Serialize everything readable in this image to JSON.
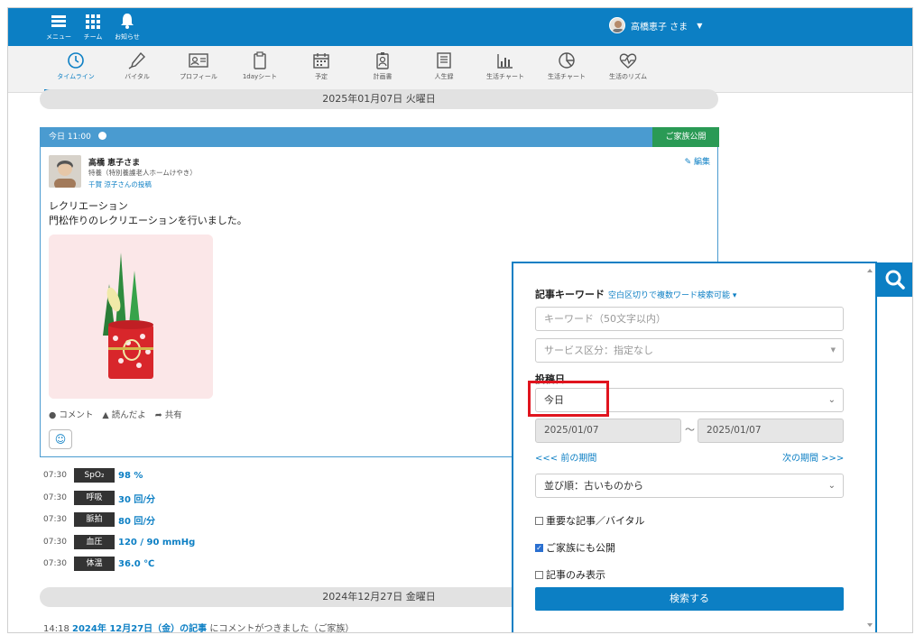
{
  "header": {
    "menu_label": "メニュー",
    "team_label": "チーム",
    "notice_label": "お知らせ",
    "user_name": "高橋恵子 さま",
    "user_menu_icon": "caret-down-icon"
  },
  "tabs": [
    {
      "label": "タイムライン",
      "icon": "clock-icon",
      "active": true
    },
    {
      "label": "バイタル",
      "icon": "thermometer-icon"
    },
    {
      "label": "プロフィール",
      "icon": "id-card-icon"
    },
    {
      "label": "1dayシート",
      "icon": "clipboard-icon"
    },
    {
      "label": "予定",
      "icon": "calendar-icon"
    },
    {
      "label": "計画書",
      "icon": "badge-icon"
    },
    {
      "label": "人生録",
      "icon": "notebook-icon"
    },
    {
      "label": "生活チャート",
      "icon": "bar-chart-icon"
    },
    {
      "label": "生活チャート",
      "icon": "pie-chart-icon"
    },
    {
      "label": "生活のリズム",
      "icon": "heartbeat-icon"
    }
  ],
  "timeline": {
    "date1": "2025年01月07日 火曜日",
    "date2": "2024年12月27日 金曜日"
  },
  "post": {
    "time": "今日 11:00",
    "family_tag": "ご家族公開",
    "edit_label": "編集",
    "name": "高橋 恵子さま",
    "facility": "特養（特別養護老人ホームけやき）",
    "posted_by": "千賀 涼子さんの投稿",
    "title": "レクリエーション",
    "body": "門松作りのレクリエーションを行いました。",
    "comment_label": "コメント",
    "read_label": "読んだよ",
    "share_label": "共有",
    "emoji_label": "☺"
  },
  "vitals": [
    {
      "time": "07:30",
      "name": "SpO₂",
      "value": "98 %"
    },
    {
      "time": "07:30",
      "name": "呼吸",
      "value": "30 回/分"
    },
    {
      "time": "07:30",
      "name": "脈拍",
      "value": "80 回/分"
    },
    {
      "time": "07:30",
      "name": "血圧",
      "value": "120 / 90 mmHg"
    },
    {
      "time": "07:30",
      "name": "体温",
      "value": "36.0 ℃"
    }
  ],
  "notice": {
    "time": "14:18",
    "link": "2024年 12月27日（金）の記事",
    "text": "にコメントがつきました（ご家族）"
  },
  "search": {
    "keyword_label": "記事キーワード",
    "keyword_hint": "空白区切りで複数ワード検索可能 ▾",
    "keyword_placeholder": "キーワード（50文字以内）",
    "service_value": "サービス区分：指定なし",
    "date_label": "投稿日",
    "date_value": "今日",
    "date_from": "2025/01/07",
    "date_to": "2025/01/07",
    "range_sep": "〜",
    "prev_period": "<<< 前の期間",
    "next_period": "次の期間 >>>",
    "sort_value": "並び順：古いものから",
    "check_important": "重要な記事／バイタル",
    "check_family": "ご家族にも公開",
    "check_only_posts": "記事のみ表示",
    "submit_label": "検索する"
  },
  "colors": {
    "primary": "#0c7fc4",
    "family_green": "#2a9a55",
    "highlight": "#e0141e"
  }
}
